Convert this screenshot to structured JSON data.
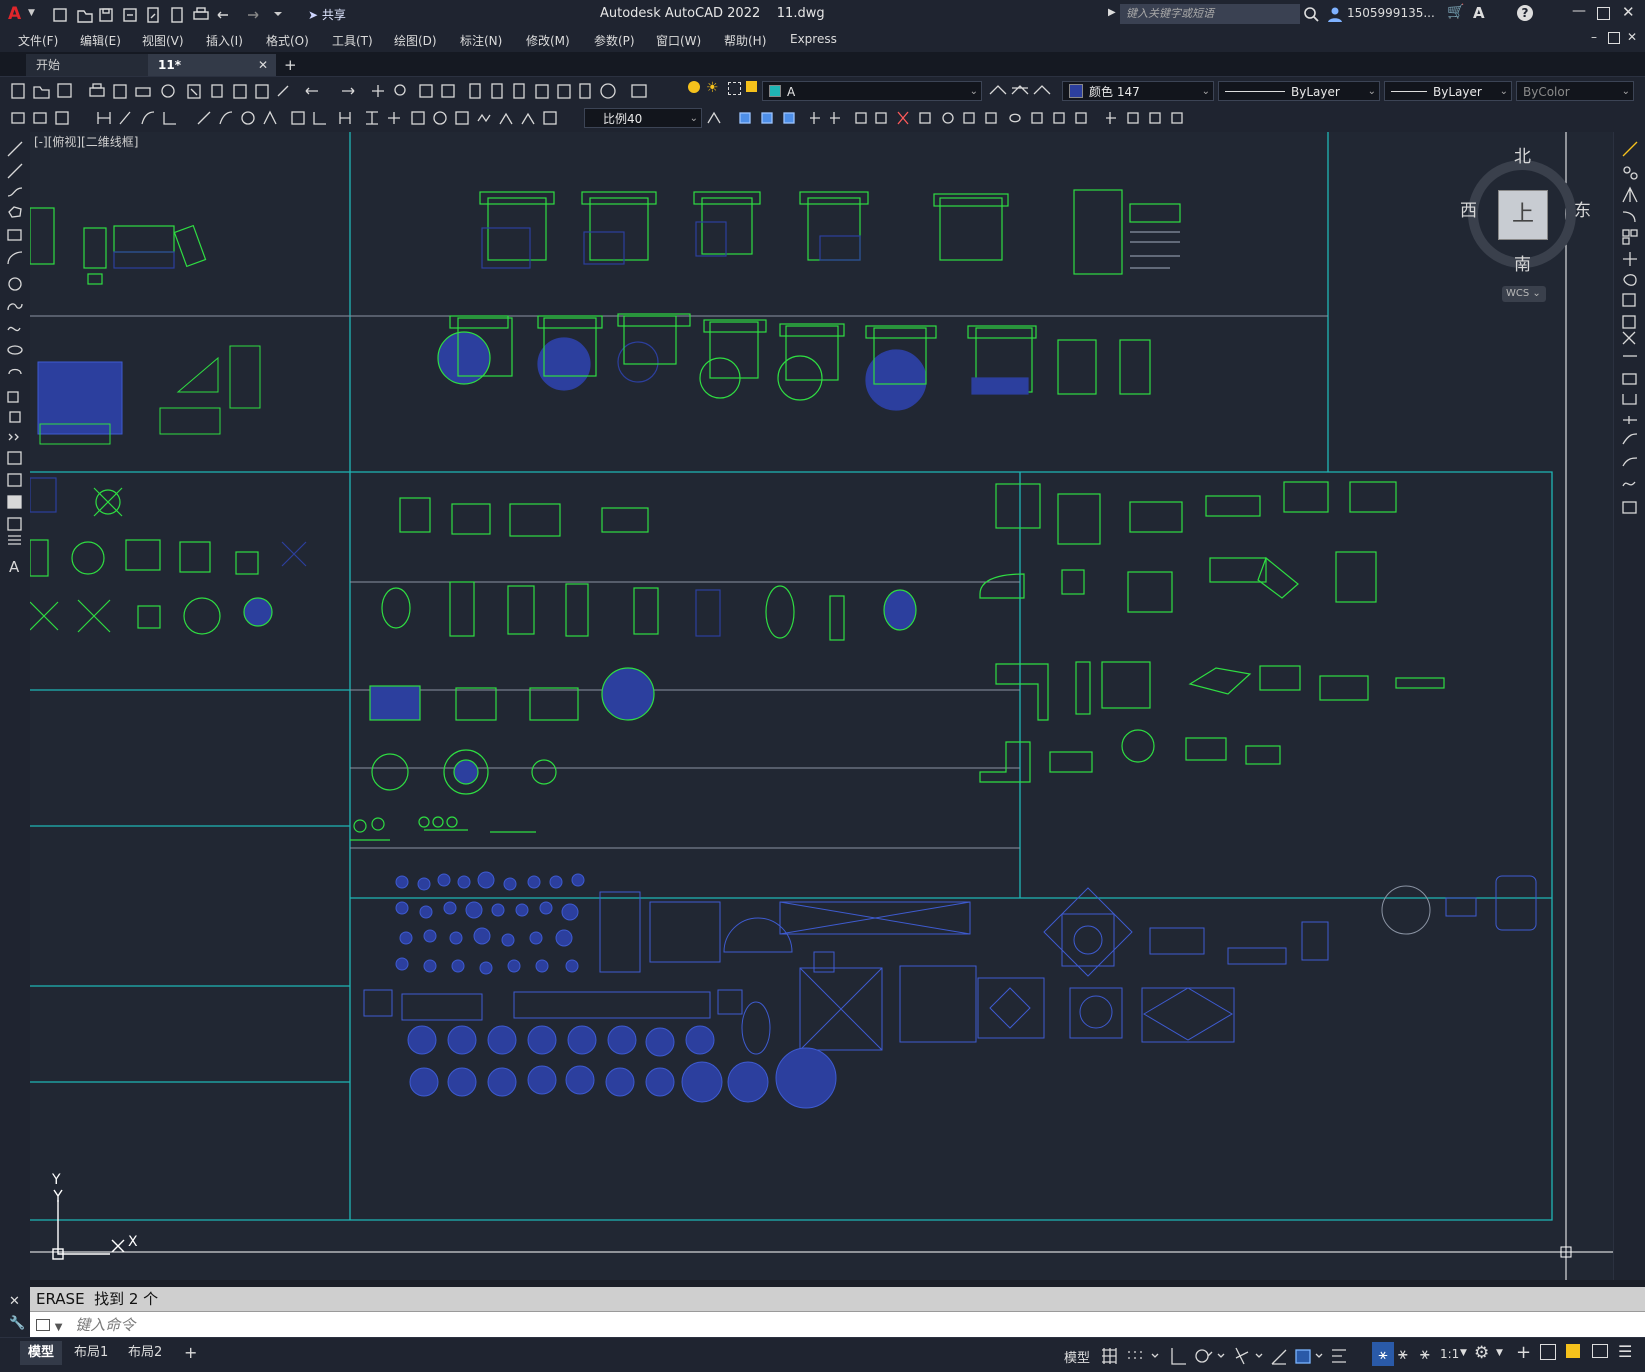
{
  "app": {
    "title": "Autodesk AutoCAD 2022    11.dwg",
    "share_label": "共享",
    "search_placeholder": "键入关键字或短语",
    "user": "1505999135...",
    "express": "Express"
  },
  "menu": [
    "文件(F)",
    "编辑(E)",
    "视图(V)",
    "插入(I)",
    "格式(O)",
    "工具(T)",
    "绘图(D)",
    "标注(N)",
    "修改(M)",
    "参数(P)",
    "窗口(W)",
    "帮助(H)",
    "Express"
  ],
  "tabs": {
    "start": "开始",
    "current": "11*",
    "close": "✕",
    "add": "+"
  },
  "layer": {
    "name": "A"
  },
  "properties": {
    "color": "颜色 147",
    "linetype": "ByLayer",
    "lineweight": "ByLayer",
    "plotstyle": "ByColor"
  },
  "annotation_scale": "比例40",
  "viewport": {
    "label": "[-][俯视][二维线框]",
    "cube": {
      "north": "北",
      "south": "南",
      "east": "东",
      "west": "西",
      "top": "上",
      "wcs": "WCS"
    },
    "ucs": {
      "x": "X",
      "y": "Y"
    }
  },
  "colors": {
    "frame": "#1fb5b5",
    "green": "#2fdd42",
    "blue": "#2c3f9e",
    "bg": "#212733"
  },
  "command": {
    "history": "ERASE  找到 2 个",
    "placeholder": "键入命令"
  },
  "layouts": [
    "模型",
    "布局1",
    "布局2"
  ],
  "layout_add": "+",
  "status": {
    "model": "模型",
    "scale": "1:1"
  }
}
